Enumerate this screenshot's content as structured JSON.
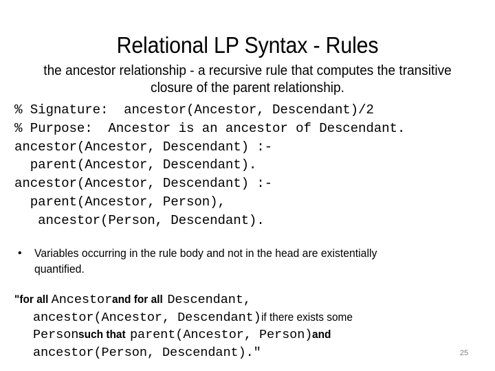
{
  "slide": {
    "title": "Relational LP Syntax - Rules",
    "subtitle": "the ancestor relationship - a recursive rule that computes the transitive closure of the parent relationship.",
    "page_number": "25",
    "page_number_color": "#808080",
    "background_color": "#ffffff",
    "text_color": "#000000"
  },
  "code_block": {
    "lines": [
      "% Signature:  ancestor(Ancestor, Descendant)/2",
      "% Purpose:  Ancestor is an ancestor of Descendant.",
      "ancestor(Ancestor, Descendant) :-",
      "  parent(Ancestor, Descendant).",
      "ancestor(Ancestor, Descendant) :-",
      "  parent(Ancestor, Person),",
      "   ancestor(Person, Descendant)."
    ]
  },
  "bullets": [
    {
      "marker": "•",
      "text": "Variables occurring in the rule body and not in the head are existentially quantified."
    }
  ],
  "quote": {
    "lines": [
      {
        "indent": false,
        "segments": [
          {
            "style": "prop",
            "text": "\"for all "
          },
          {
            "style": "mono",
            "text": "Ancestor"
          },
          {
            "style": "prop",
            "text": "  and for all "
          },
          {
            "style": "mono",
            "text": "Descendant,"
          }
        ]
      },
      {
        "indent": true,
        "segments": [
          {
            "style": "mono",
            "text": "ancestor(Ancestor, Descendant)"
          },
          {
            "style": "prop-light",
            "text": "  if there exists some"
          }
        ]
      },
      {
        "indent": true,
        "segments": [
          {
            "style": "mono",
            "text": "Person"
          },
          {
            "style": "prop",
            "text": "  such that "
          },
          {
            "style": "mono",
            "text": "parent(Ancestor, Person)"
          },
          {
            "style": "prop",
            "text": "  and"
          }
        ]
      },
      {
        "indent": true,
        "segments": [
          {
            "style": "mono",
            "text": "ancestor(Person, Descendant).\""
          }
        ]
      }
    ]
  }
}
